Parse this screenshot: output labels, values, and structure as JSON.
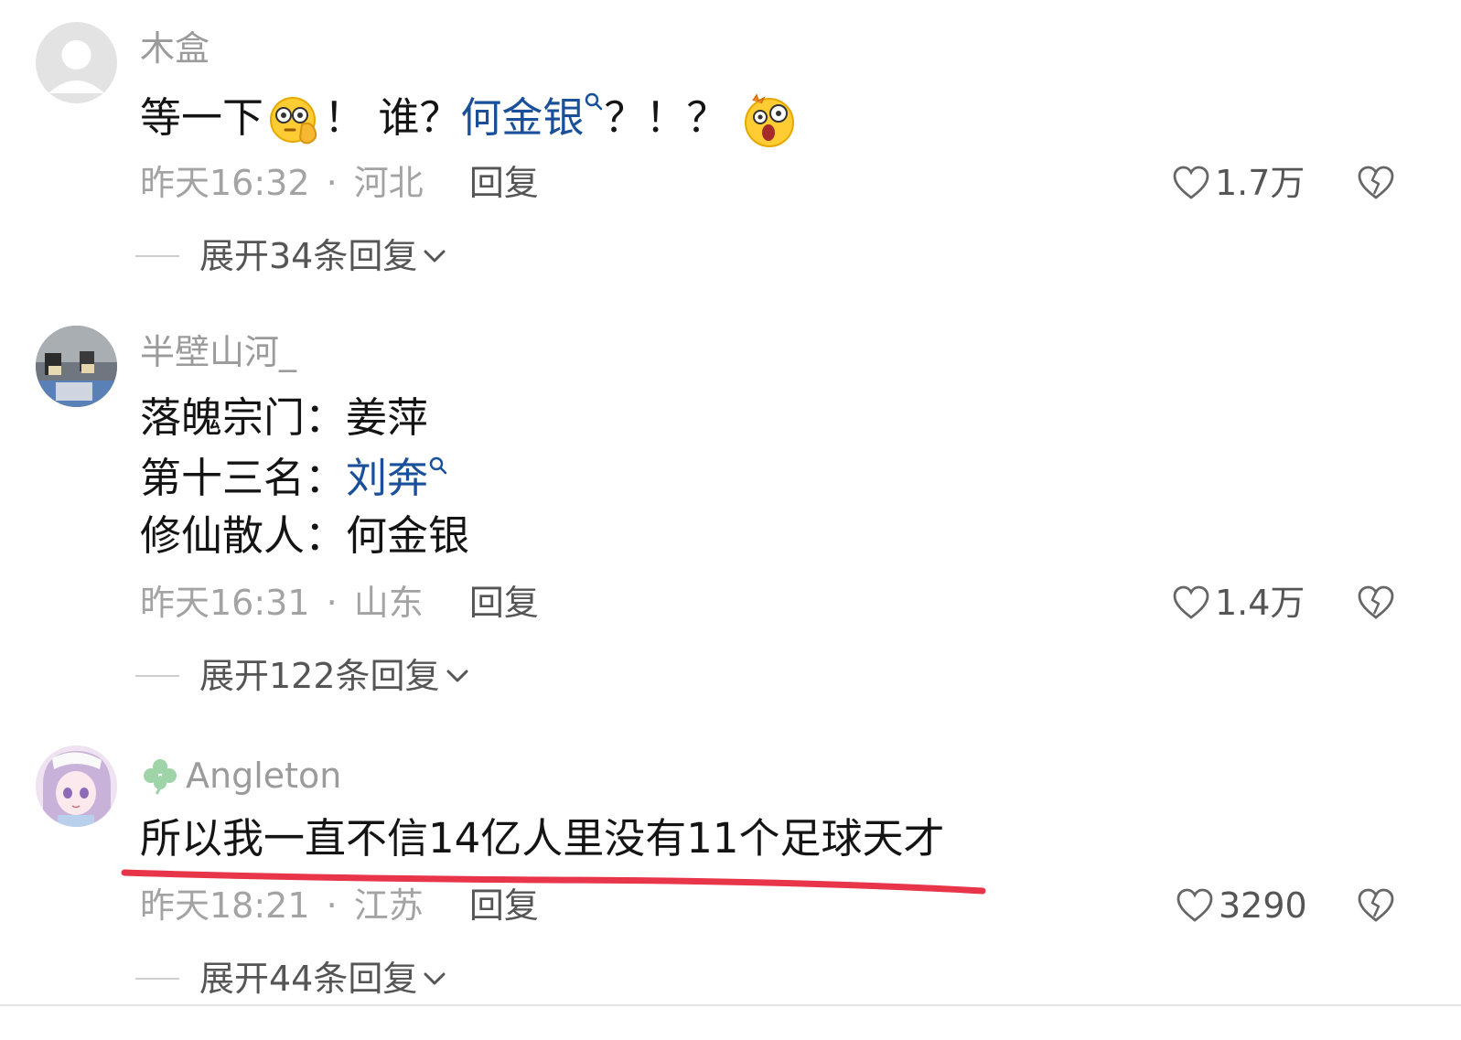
{
  "comments": [
    {
      "username": "木盒",
      "avatar": "default-avatar",
      "text_parts": [
        "等一下",
        "！  谁？",
        "何金银",
        "？！？"
      ],
      "time": "昨天16:32",
      "location": "河北",
      "reply_label": "回复",
      "likes": "1.7万",
      "expand": "展开34条回复"
    },
    {
      "username": "半壁山河_",
      "avatar": "photo-avatar",
      "lines": [
        {
          "prefix": "落魄宗门：",
          "name": "姜萍"
        },
        {
          "prefix": "第十三名：",
          "name": "刘奔"
        },
        {
          "prefix": "修仙散人：",
          "name": "何金银"
        }
      ],
      "time": "昨天16:31",
      "location": "山东",
      "reply_label": "回复",
      "likes": "1.4万",
      "expand": "展开122条回复"
    },
    {
      "username": "Angleton",
      "avatar": "anime-avatar",
      "text": "所以我一直不信14亿人里没有11个足球天才",
      "time": "昨天18:21",
      "location": "江苏",
      "reply_label": "回复",
      "likes": "3290",
      "expand": "展开44条回复"
    }
  ],
  "meta_separator": "·",
  "colors": {
    "mention": "#1a4f9a",
    "underline": "#e8354a"
  },
  "icons": [
    "heart-icon",
    "broken-heart-icon",
    "chevron-down-icon",
    "search-icon",
    "clover-icon"
  ]
}
